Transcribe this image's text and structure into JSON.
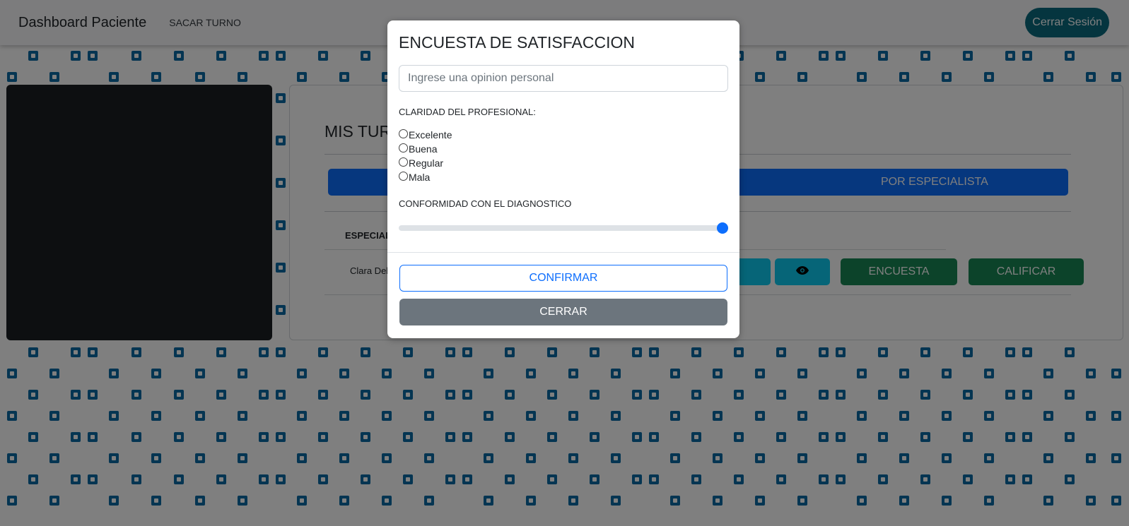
{
  "navbar": {
    "brand": "Dashboard Paciente",
    "nav_link": "SACAR TURNO",
    "logout_label": "Cerrar Sesión"
  },
  "main": {
    "title": "MIS TUR",
    "por_especialista_label": "POR ESPECIALISTA",
    "column_header": "ESPECIAL",
    "row": {
      "name": "Clara Del",
      "view_icon": "eye-icon",
      "encuesta_label": "ENCUESTA",
      "calificar_label": "CALIFICAR"
    }
  },
  "modal": {
    "title": "ENCUESTA DE SATISFACCION",
    "opinion_placeholder": "Ingrese una opinion personal",
    "opinion_value": "",
    "claridad_label": "CLARIDAD DEL PROFESIONAL:",
    "claridad_options": [
      "Excelente",
      "Buena",
      "Regular",
      "Mala"
    ],
    "conformidad_label": "CONFORMIDAD CON EL DIAGNOSTICO",
    "conformidad_value": 1.0,
    "confirm_label": "CONFIRMAR",
    "close_label": "CERRAR"
  },
  "colors": {
    "primary": "#0d6efd",
    "secondary": "#6c757d",
    "success": "#198754",
    "info": "#0dcaf0",
    "logout": "#0b6a7e",
    "pattern": "#0a6aa5"
  }
}
